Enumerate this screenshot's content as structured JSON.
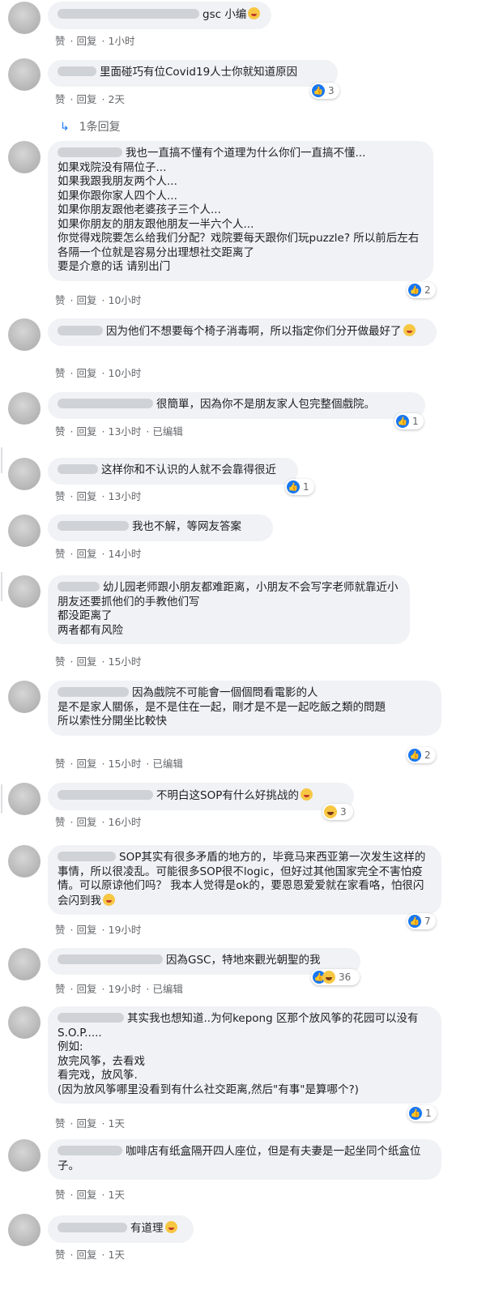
{
  "actions": {
    "like": "赞",
    "reply": "回复",
    "edited": "已编辑",
    "sep": "·"
  },
  "reply_link": {
    "text": "1条回复"
  },
  "comments": [
    {
      "text": "gsc 小编",
      "time": "1小时",
      "emoji": "laugh"
    },
    {
      "text": "里面碰巧有位Covid19人士你就知道原因",
      "time": "2天",
      "reaction_count": "3",
      "reaction_type": "like"
    },
    {
      "text": "我也一直搞不懂有个道理为什么你们一直搞不懂...\n如果戏院没有隔位子...\n如果我跟我朋友两个人...\n如果你跟你家人四个人...\n如果你朋友跟他老婆孩子三个人...\n如果你朋友的朋友跟他朋友一半六个人...\n你觉得戏院要怎么给我们分配？戏院要每天跟你们玩puzzle? 所以前后左右各隔一个位就是容易分出理想社交距离了\n要是介意的话 请别出门",
      "time": "10小时",
      "reaction_count": "2",
      "reaction_type": "like"
    },
    {
      "text": "因为他们不想要每个椅子消毒啊，所以指定你们分开做最好了",
      "time": "10小时",
      "emoji": "laugh"
    },
    {
      "text": "很簡單，因為你不是朋友家人包完整個戲院。",
      "time": "13小时",
      "edited": true,
      "reaction_count": "1",
      "reaction_type": "like"
    },
    {
      "text": "这样你和不认识的人就不会靠得很近",
      "time": "13小时",
      "reaction_count": "1",
      "reaction_type": "like"
    },
    {
      "text": "我也不解，等网友答案",
      "time": "14小时"
    },
    {
      "text": "幼儿园老师跟小朋友都难距离，小朋友不会写字老师就靠近小朋友还要抓他们的手教他们写\n都没距离了\n两者都有风险",
      "time": "15小时"
    },
    {
      "text": "因為戲院不可能會一個個問看電影的人\n是不是家人關係，是不是住在一起，剛才是不是一起吃飯之類的問題\n所以索性分開坐比較快",
      "time": "15小时",
      "edited": true,
      "reaction_count": "2",
      "reaction_type": "like"
    },
    {
      "text": "不明白这SOP有什么好挑战的",
      "time": "16小时",
      "emoji": "think",
      "reaction_count": "3",
      "reaction_type": "haha"
    },
    {
      "text": "SOP其实有很多矛盾的地方的，毕竟马来西亚第一次发生这样的事情，所以很凌乱。可能很多SOP很不logic，但好过其他国家完全不害怕疫情。可以原谅他们吗？ 我本人觉得是ok的，要恩恩爱爱就在家看咯，怕很闪会闪到我",
      "time": "19小时",
      "reaction_count": "7",
      "reaction_type": "like"
    },
    {
      "text": "因為GSC，特地來觀光朝聖的我",
      "time": "19小时",
      "edited": true,
      "reaction_count": "36",
      "reaction_type": "like-haha"
    },
    {
      "text": "其实我也想知道..为何kepong 区那个放风筝的花园可以没有S.O.P.....\n例如:\n放完风筝，去看戏\n看完戏，放风筝.\n(因为放风筝哪里没看到有什么社交距离,然后\"有事\"是算哪个?)",
      "time": "1天",
      "reaction_count": "1",
      "reaction_type": "like"
    },
    {
      "text": "咖啡店有纸盒隔开四人座位，但是有夫妻是一起坐同个纸盒位子。",
      "time": "1天"
    },
    {
      "text": "有道理",
      "time": "1天",
      "emoji": "laugh"
    }
  ]
}
